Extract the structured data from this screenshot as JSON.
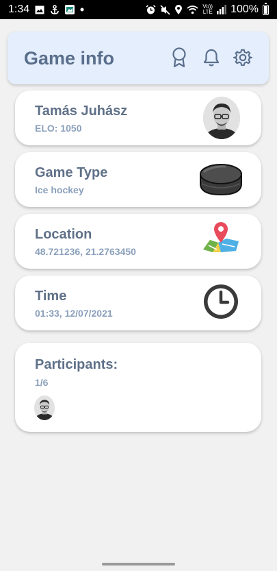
{
  "status_bar": {
    "time": "1:34",
    "battery": "100%",
    "volte": "Vo))\nLTE",
    "icons": [
      "image-icon",
      "anchor-icon",
      "app-icon",
      "dot",
      "alarm-icon",
      "mute-icon",
      "location-icon",
      "wifi-icon",
      "volte-icon",
      "signal-icon",
      "battery-icon"
    ]
  },
  "header": {
    "title": "Game info",
    "icons": [
      "award-icon",
      "bell-icon",
      "gear-icon"
    ]
  },
  "cards": {
    "player": {
      "title": "Tamás Juhász",
      "sub": "ELO: 1050",
      "icon": "avatar"
    },
    "game_type": {
      "title": "Game Type",
      "sub": "Ice hockey",
      "icon": "hockey-puck-icon"
    },
    "location": {
      "title": "Location",
      "sub": "48.721236, 21.2763450",
      "icon": "map-pin-icon"
    },
    "time": {
      "title": "Time",
      "sub": "01:33, 12/07/2021",
      "icon": "clock-icon"
    },
    "participants": {
      "title": "Participants:",
      "sub": "1/6",
      "icon": "avatar"
    }
  },
  "colors": {
    "header_bg": "#e4eefc",
    "title_text": "#5f7088",
    "sub_text": "#8ba0bb",
    "page_bg": "#f1f1f1"
  }
}
